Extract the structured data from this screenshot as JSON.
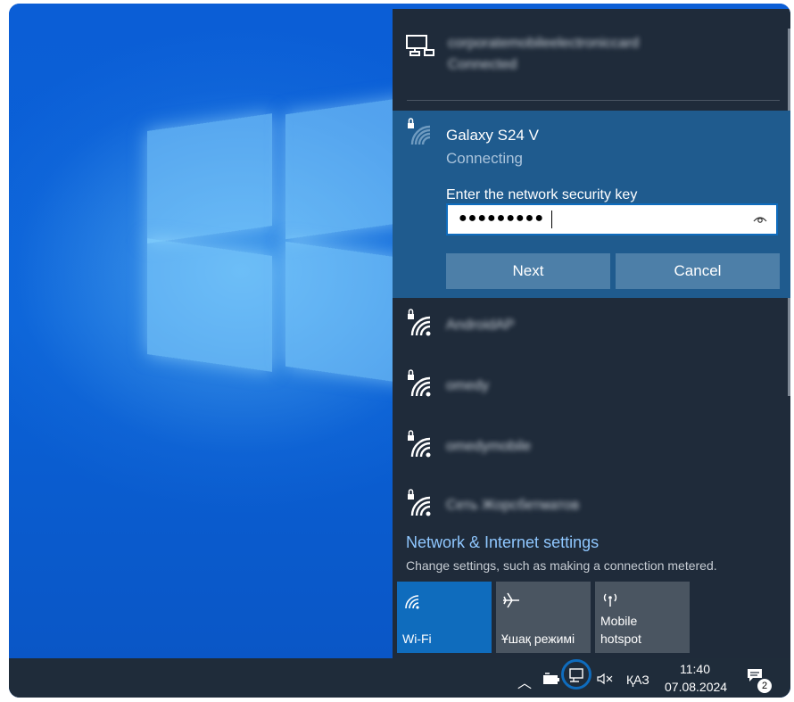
{
  "flyout": {
    "connected_network": {
      "name": "corporatemobileelectroniccard",
      "status": "Connected"
    },
    "selected_network": {
      "name": "Galaxy S24 V",
      "status": "Connecting",
      "key_label": "Enter the network security key",
      "key_value": "●●●●●●●●●",
      "next_label": "Next",
      "cancel_label": "Cancel"
    },
    "networks": [
      {
        "name": "AndroidAP"
      },
      {
        "name": "omedy"
      },
      {
        "name": "omedymobile"
      },
      {
        "name": "Сеть Жорсбетматов"
      }
    ],
    "settings_link": "Network & Internet settings",
    "settings_desc": "Change settings, such as making a connection metered.",
    "quick_actions": [
      {
        "label": "Wi-Fi",
        "icon": "wifi-icon",
        "active": true
      },
      {
        "label": "Ұшақ режимі",
        "icon": "airplane-icon",
        "active": false
      },
      {
        "label": "Mobile hotspot",
        "icon": "hotspot-icon",
        "active": false
      }
    ]
  },
  "taskbar": {
    "language": "ҚАЗ",
    "time": "11:40",
    "date": "07.08.2024",
    "notification_count": "2"
  },
  "colors": {
    "accent": "#0f6cbd",
    "selected_bg": "#1f5b8e",
    "flyout_bg": "#1f2b3a",
    "link": "#8fc7ff"
  }
}
